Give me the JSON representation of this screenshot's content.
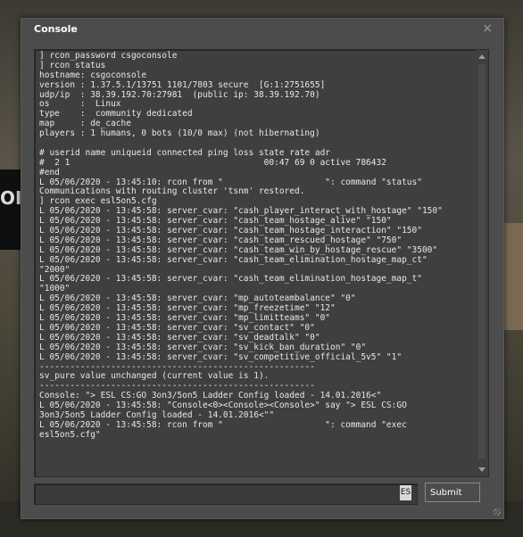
{
  "background": {
    "left_text": "OIN"
  },
  "window": {
    "title": "Console",
    "close_glyph": "×"
  },
  "console": {
    "lines": [
      "] rcon_password csgoconsole",
      "] rcon status",
      "hostname: csgoconsole",
      "version : 1.37.5.1/13751 1101/7803 secure  [G:1:2751655]",
      "udp/ip  : 38.39.192.70:27981  (public ip: 38.39.192.70)",
      "os      :  Linux",
      "type    :  community dedicated",
      "map     : de_cache",
      "players : 1 humans, 0 bots (10/0 max) (not hibernating)",
      "",
      "# userid name uniqueid connected ping loss state rate adr",
      "#  2 1                                      00:47 69 0 active 786432",
      "#end",
      "L 05/06/2020 - 13:45:10: rcon from \"                    \": command \"status\"",
      "Communications with routing cluster 'tsnm' restored.",
      "] rcon exec esl5on5.cfg",
      "L 05/06/2020 - 13:45:58: server_cvar: \"cash_player_interact_with_hostage\" \"150\"",
      "L 05/06/2020 - 13:45:58: server_cvar: \"cash_team_hostage_alive\" \"150\"",
      "L 05/06/2020 - 13:45:58: server_cvar: \"cash_team_hostage_interaction\" \"150\"",
      "L 05/06/2020 - 13:45:58: server_cvar: \"cash_team_rescued_hostage\" \"750\"",
      "L 05/06/2020 - 13:45:58: server_cvar: \"cash_team_win_by_hostage_rescue\" \"3500\"",
      "L 05/06/2020 - 13:45:58: server_cvar: \"cash_team_elimination_hostage_map_ct\"",
      "\"2000\"",
      "L 05/06/2020 - 13:45:58: server_cvar: \"cash_team_elimination_hostage_map_t\"",
      "\"1000\"",
      "L 05/06/2020 - 13:45:58: server_cvar: \"mp_autoteambalance\" \"0\"",
      "L 05/06/2020 - 13:45:58: server_cvar: \"mp_freezetime\" \"12\"",
      "L 05/06/2020 - 13:45:58: server_cvar: \"mp_limitteams\" \"0\"",
      "L 05/06/2020 - 13:45:58: server_cvar: \"sv_contact\" \"0\"",
      "L 05/06/2020 - 13:45:58: server_cvar: \"sv_deadtalk\" \"0\"",
      "L 05/06/2020 - 13:45:58: server_cvar: \"sv_kick_ban_duration\" \"0\"",
      "L 05/06/2020 - 13:45:58: server_cvar: \"sv_competitive_official_5v5\" \"1\"",
      "------------------------------------------------------",
      "sv_pure value unchanged (current value is 1).",
      "------------------------------------------------------",
      "Console: \"> ESL CS:GO 3on3/5on5 Ladder Config loaded - 14.01.2016<\"",
      "L 05/06/2020 - 13:45:58: \"Console<0><Console><Console>\" say \"> ESL CS:GO",
      "3on3/5on5 Ladder Config loaded - 14.01.2016<\"\"",
      "L 05/06/2020 - 13:45:58: rcon from \"                    \": command \"exec",
      "esl5on5.cfg\""
    ]
  },
  "input": {
    "value": "",
    "language_badge": "ES"
  },
  "submit_label": "Submit"
}
